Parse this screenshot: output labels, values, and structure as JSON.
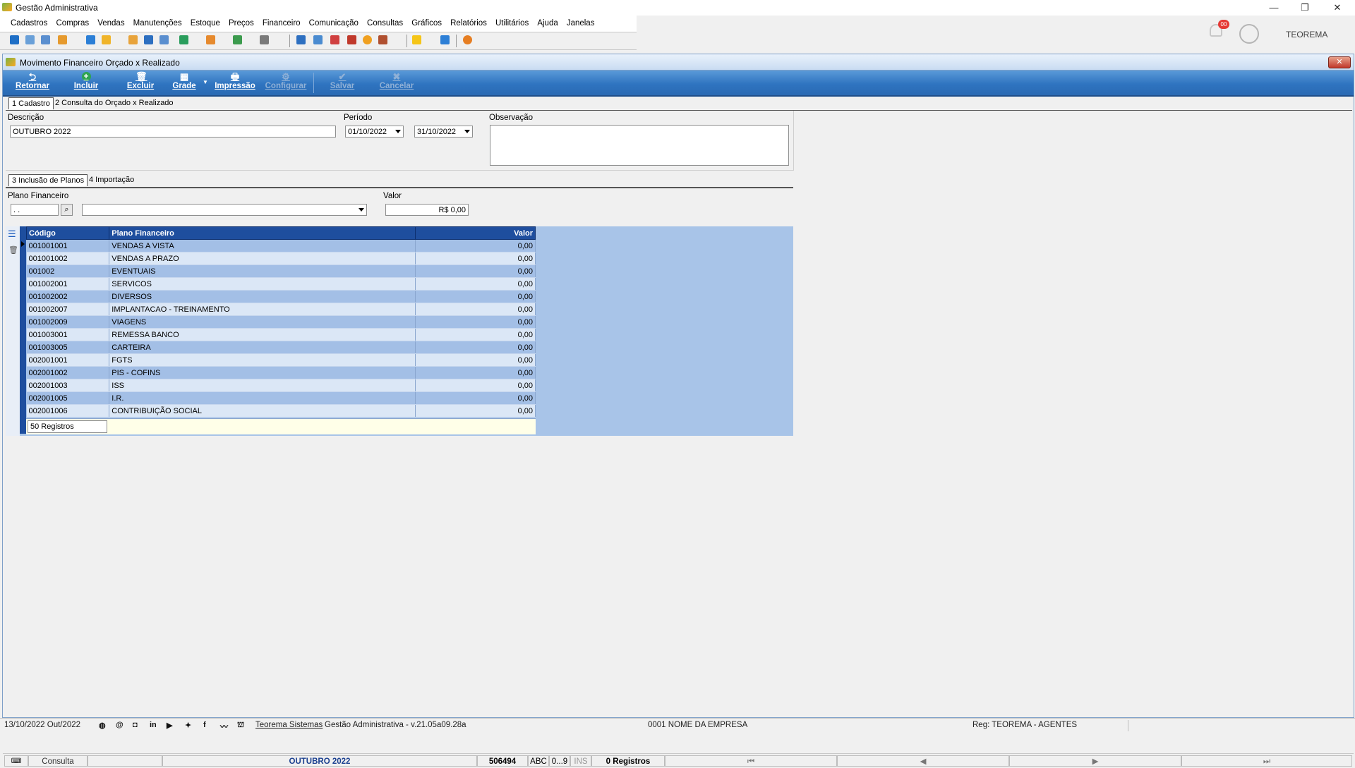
{
  "app": {
    "title": "Gestão Administrativa"
  },
  "menu": [
    "Cadastros",
    "Compras",
    "Vendas",
    "Manutenções",
    "Estoque",
    "Preços",
    "Financeiro",
    "Comunicação",
    "Consultas",
    "Gráficos",
    "Relatórios",
    "Utilitários",
    "Ajuda",
    "Janelas"
  ],
  "user": {
    "name": "TEOREMA",
    "notification_count": "00"
  },
  "child_window": {
    "title": "Movimento Financeiro Orçado x Realizado",
    "close_label": "✕"
  },
  "ribbon": {
    "retornar": "Retornar",
    "incluir": "Incluir",
    "excluir": "Excluir",
    "grade": "Grade",
    "impressao": "Impressão",
    "configurar": "Configurar",
    "salvar": "Salvar",
    "cancelar": "Cancelar"
  },
  "tabs": {
    "cadastro": "1 Cadastro",
    "consulta": "2 Consulta do Orçado x Realizado"
  },
  "form": {
    "descricao_label": "Descrição",
    "descricao_value": "OUTUBRO 2022",
    "periodo_label": "Período",
    "periodo_inicio": "01/10/2022",
    "periodo_fim": "31/10/2022",
    "observacao_label": "Observação",
    "observacao_value": ""
  },
  "subtabs": {
    "inclusao": "3 Inclusão de Planos",
    "importacao": "4 Importação"
  },
  "plano": {
    "label": "Plano Financeiro",
    "code_value": " .  .",
    "combo_value": "",
    "valor_label": "Valor",
    "valor_value": "R$ 0,00"
  },
  "grid": {
    "headers": {
      "codigo": "Código",
      "plano": "Plano Financeiro",
      "valor": "Valor"
    },
    "rows": [
      {
        "codigo": "001001001",
        "plano": "VENDAS A VISTA",
        "valor": "0,00"
      },
      {
        "codigo": "001001002",
        "plano": "VENDAS A PRAZO",
        "valor": "0,00"
      },
      {
        "codigo": "001002",
        "plano": "EVENTUAIS",
        "valor": "0,00"
      },
      {
        "codigo": "001002001",
        "plano": "SERVICOS",
        "valor": "0,00"
      },
      {
        "codigo": "001002002",
        "plano": "DIVERSOS",
        "valor": "0,00"
      },
      {
        "codigo": "001002007",
        "plano": "IMPLANTACAO - TREINAMENTO",
        "valor": "0,00"
      },
      {
        "codigo": "001002009",
        "plano": "VIAGENS",
        "valor": "0,00"
      },
      {
        "codigo": "001003001",
        "plano": "REMESSA BANCO",
        "valor": "0,00"
      },
      {
        "codigo": "001003005",
        "plano": "CARTEIRA",
        "valor": "0,00"
      },
      {
        "codigo": "002001001",
        "plano": "FGTS",
        "valor": "0,00"
      },
      {
        "codigo": "002001002",
        "plano": "PIS - COFINS",
        "valor": "0,00"
      },
      {
        "codigo": "002001003",
        "plano": "ISS",
        "valor": "0,00"
      },
      {
        "codigo": "002001005",
        "plano": "I.R.",
        "valor": "0,00"
      },
      {
        "codigo": "002001006",
        "plano": "CONTRIBUIÇÃO SOCIAL",
        "valor": "0,00"
      }
    ],
    "footer": "50 Registros"
  },
  "status": {
    "mode": "Consulta",
    "descricao": "OUTUBRO 2022",
    "id": "506494",
    "abc": "ABC",
    "num": "0...9",
    "ins": "INS",
    "registros": "0 Registros"
  },
  "bottom": {
    "date": "13/10/2022 Out/2022",
    "link": "Teorema Sistemas",
    "version": "Gestão Administrativa - v.21.05a09.28a",
    "empresa": "0001 NOME DA EMPRESA",
    "reg": "Reg: TEOREMA - AGENTES"
  },
  "colors": {
    "ribbon": "#2f74c0",
    "grid_header": "#1e4e9e",
    "grid_panel": "#a8c4e8",
    "accent_text": "#1a3f8f"
  }
}
